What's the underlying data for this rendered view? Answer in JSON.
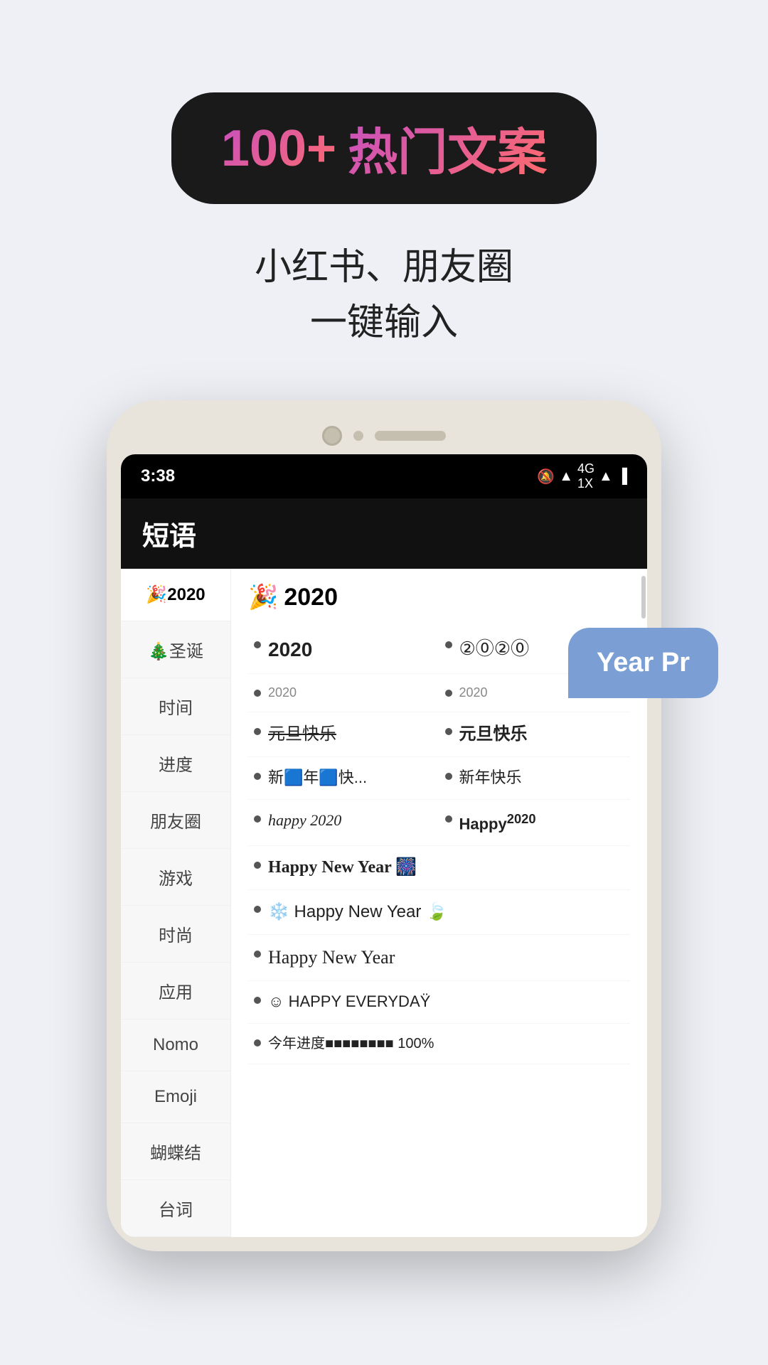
{
  "page": {
    "background": "#eef0f5"
  },
  "top_badge": {
    "number": "100+",
    "text": "热门文案"
  },
  "subtitle": {
    "line1": "小红书、朋友圈",
    "line2": "一键输入"
  },
  "phone": {
    "status_bar": {
      "time": "3:38",
      "icons": "🔕 📶 4G 1X 📶 🔋"
    },
    "app_title": "短语",
    "sidebar": {
      "items": [
        {
          "label": "🎉2020",
          "active": true
        },
        {
          "label": "🎄圣诞",
          "active": false
        },
        {
          "label": "时间",
          "active": false
        },
        {
          "label": "进度",
          "active": false
        },
        {
          "label": "朋友圈",
          "active": false
        },
        {
          "label": "游戏",
          "active": false
        },
        {
          "label": "时尚",
          "active": false
        },
        {
          "label": "应用",
          "active": false
        },
        {
          "label": "Nomo",
          "active": false
        },
        {
          "label": "Emoji",
          "active": false
        },
        {
          "label": "蝴蝶结",
          "active": false
        },
        {
          "label": "台词",
          "active": false
        }
      ]
    },
    "main": {
      "section_header": "🎉 2020",
      "items": [
        {
          "text": "2020",
          "style": "normal",
          "col": "left"
        },
        {
          "text": "②⓪②⓪",
          "style": "circled",
          "col": "right"
        },
        {
          "text": "2020",
          "style": "small",
          "col": "left"
        },
        {
          "text": "2020",
          "style": "small",
          "col": "right"
        },
        {
          "text": "元旦快乐",
          "style": "normal",
          "col": "left"
        },
        {
          "text": "元旦快乐",
          "style": "bold",
          "col": "right"
        },
        {
          "text": "新🟦年🟦快...",
          "style": "normal",
          "col": "left"
        },
        {
          "text": "新年快乐",
          "style": "normal",
          "col": "right"
        },
        {
          "text": "happy 2020",
          "style": "italic",
          "col": "left"
        },
        {
          "text": "Happy²⁰²⁰",
          "style": "bold",
          "col": "right"
        },
        {
          "text": "Happy New Year 🎆",
          "style": "normal",
          "col": "full"
        },
        {
          "text": "❄️ Happy New Year 🍃",
          "style": "normal",
          "col": "full"
        },
        {
          "text": "Happy New Year",
          "style": "script",
          "col": "full"
        },
        {
          "text": "☺ HAPPY EVERYDAŸ",
          "style": "normal",
          "col": "full"
        },
        {
          "text": "今年进度■■■■■■■■ 100%",
          "style": "normal",
          "col": "full"
        }
      ]
    },
    "tooltip": "Year Pr"
  }
}
